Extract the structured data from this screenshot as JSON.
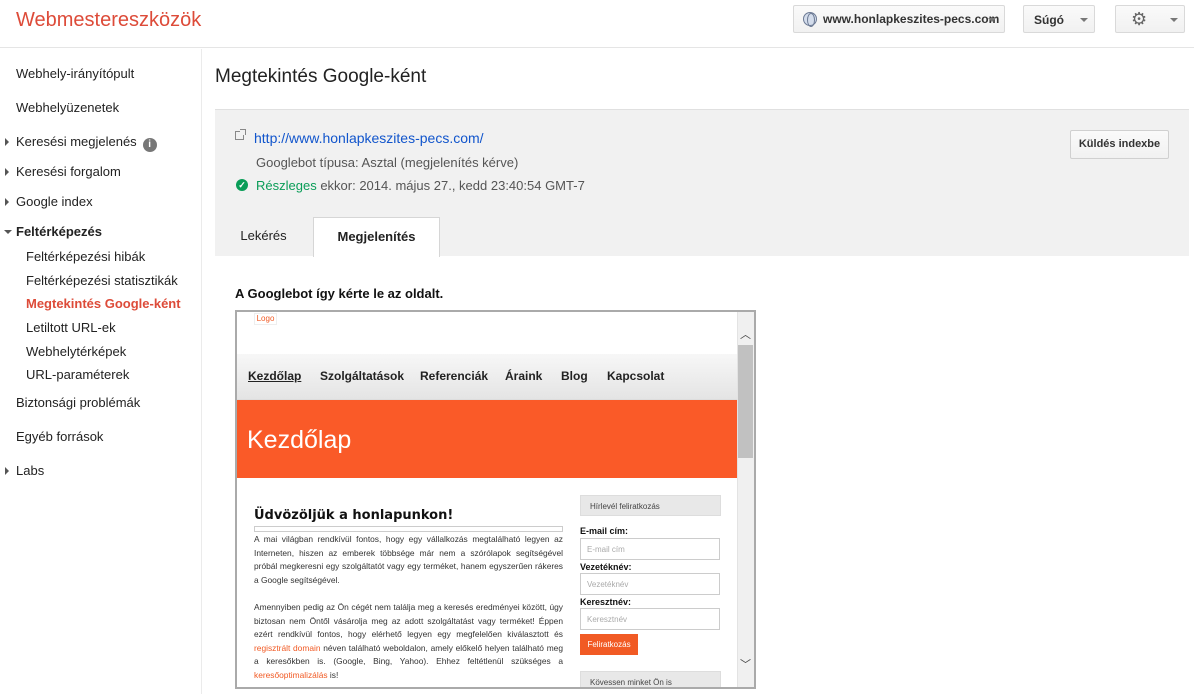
{
  "header": {
    "app_title": "Webmestereszközök",
    "site_selector": "www.honlapkeszites-pecs.com",
    "help_label": "Súgó",
    "settings_icon": "gear-icon"
  },
  "sidebar": {
    "items": [
      {
        "label": "Webhely-irányítópult"
      },
      {
        "label": "Webhelyüzenetek"
      },
      {
        "label": "Keresési megjelenés"
      },
      {
        "label": "Keresési forgalom"
      },
      {
        "label": "Google index"
      },
      {
        "label": "Feltérképezés"
      },
      {
        "label": "Feltérképezési hibák"
      },
      {
        "label": "Feltérképezési statisztikák"
      },
      {
        "label": "Megtekintés Google-ként"
      },
      {
        "label": "Letiltott URL-ek"
      },
      {
        "label": "Webhelytérképek"
      },
      {
        "label": "URL-paraméterek"
      },
      {
        "label": "Biztonsági problémák"
      },
      {
        "label": "Egyéb források"
      },
      {
        "label": "Labs"
      }
    ],
    "info_glyph": "i"
  },
  "main": {
    "page_title": "Megtekintés Google-ként",
    "fetch": {
      "url": "http://www.honlapkeszites-pecs.com/",
      "googlebot_type": "Googlebot típusa: Asztal (megjelenítés kérve)",
      "status_label": "Részleges",
      "status_rest": " ekkor: 2014. május 27., kedd 23:40:54 GMT-7",
      "submit_label": "Küldés indexbe"
    },
    "tabs": [
      {
        "label": "Lekérés"
      },
      {
        "label": "Megjelenítés"
      }
    ],
    "render_caption": "A Googlebot így kérte le az oldalt."
  },
  "preview": {
    "logo": "Logo",
    "menu": [
      "Kezdőlap",
      "Szolgáltatások",
      "Referenciák",
      "Áraink",
      "Blog",
      "Kapcsolat"
    ],
    "hero_title": "Kezdőlap",
    "welcome_heading": "Üdvözöljük a honlapunkon!",
    "para1": "A mai világban rendkívül fontos, hogy egy vállalkozás megtalálható legyen az Interneten, hiszen az emberek többsége már nem a szórólapok segítségével próbál megkeresni egy szolgáltatót vagy egy terméket, hanem egyszerűen rákeres a Google segítségével.",
    "para2_a": "Amennyiben pedig az Ön cégét nem találja meg a keresés eredményei között, úgy biztosan nem Öntől vásárolja meg az adott szolgáltatást vagy terméket! Éppen ezért rendkívül fontos, hogy elérhető legyen egy megfelelően kiválasztott és ",
    "para2_link": "regisztrált domain",
    "para2_b": " néven található weboldalon, amely előkelő helyen található meg a keresőkben is. (Google, Bing, Yahoo). Ehhez feltétlenül szükséges a ",
    "para2_link2": "keresőoptimalizálás",
    "para2_c": " is!",
    "newsletter_title": "Hírlevél feliratkozás",
    "email_label": "E-mail cím:",
    "email_placeholder": "E-mail cím",
    "lastname_label": "Vezetéknév:",
    "lastname_placeholder": "Vezetéknév",
    "firstname_label": "Keresztnév:",
    "firstname_placeholder": "Keresztnév",
    "subscribe_label": "Feliratkozás",
    "follow_title": "Kövessen minket Ön is"
  }
}
